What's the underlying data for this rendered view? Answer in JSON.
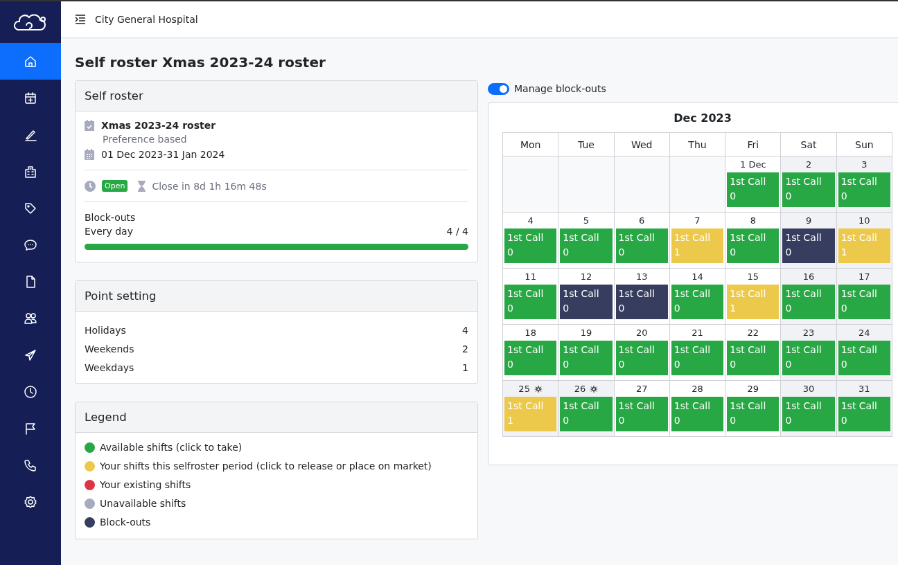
{
  "topbar": {
    "title": "City General Hospital"
  },
  "sidebar": {
    "items": [
      {
        "kind": "home",
        "selected": true
      },
      {
        "kind": "calendar-plus",
        "selected": false
      },
      {
        "kind": "pen",
        "selected": false
      },
      {
        "kind": "building",
        "selected": false
      },
      {
        "kind": "tag",
        "selected": false
      },
      {
        "kind": "chat",
        "selected": false
      },
      {
        "kind": "document",
        "selected": false
      },
      {
        "kind": "users",
        "selected": false
      },
      {
        "kind": "plane",
        "selected": false
      },
      {
        "kind": "clock",
        "selected": false
      },
      {
        "kind": "flag",
        "selected": false
      },
      {
        "kind": "phone",
        "selected": false
      },
      {
        "kind": "gear",
        "selected": false
      }
    ]
  },
  "page_title": "Self roster Xmas 2023-24 roster",
  "self_roster": {
    "heading": "Self roster",
    "name": "Xmas 2023-24 roster",
    "type": "Preference based",
    "dates": "01 Dec 2023-31 Jan 2024",
    "status": "Open",
    "countdown": "Close in 8d 1h 16m 48s",
    "blockouts_label": "Block-outs",
    "blockouts_period": "Every day",
    "blockouts_count": "4 / 4",
    "level": 1
  },
  "point_setting": {
    "heading": "Point setting",
    "rows": [
      {
        "label": "Holidays",
        "value": "4"
      },
      {
        "label": "Weekends",
        "value": "2"
      },
      {
        "label": "Weekdays",
        "value": "1"
      }
    ]
  },
  "legend": {
    "heading": "Legend",
    "items": [
      {
        "label": "Available shifts (click to take)",
        "color": "#28a745"
      },
      {
        "label": "Your shifts this selfroster period (click to release or place on market)",
        "color": "#ecc94b"
      },
      {
        "label": "Your existing shifts",
        "color": "#dc3545"
      },
      {
        "label": "Unavailable shifts",
        "color": "#a8abbd"
      },
      {
        "label": "Block-outs",
        "color": "#373d5e"
      }
    ]
  },
  "manage_blockouts": {
    "label": "Manage block-outs",
    "on": true
  },
  "calendar": {
    "month": "Dec 2023",
    "weekdays": [
      "Mon",
      "Tue",
      "Wed",
      "Thu",
      "Fri",
      "Sat",
      "Sun"
    ],
    "weeks": [
      [
        {
          "kind": "empty"
        },
        {
          "kind": "empty"
        },
        {
          "kind": "empty"
        },
        {
          "kind": "empty"
        },
        {
          "kind": "weekday",
          "day": "1 Dec",
          "shift": {
            "label": "1st Call",
            "count": "0",
            "color": "#28a745"
          }
        },
        {
          "kind": "weekend",
          "day": "2",
          "shift": {
            "label": "1st Call",
            "count": "0",
            "color": "#28a745"
          }
        },
        {
          "kind": "weekend",
          "day": "3",
          "shift": {
            "label": "1st Call",
            "count": "0",
            "color": "#28a745"
          }
        }
      ],
      [
        {
          "kind": "weekday",
          "day": "4",
          "shift": {
            "label": "1st Call",
            "count": "0",
            "color": "#28a745"
          }
        },
        {
          "kind": "weekday",
          "day": "5",
          "shift": {
            "label": "1st Call",
            "count": "0",
            "color": "#28a745"
          }
        },
        {
          "kind": "weekday",
          "day": "6",
          "shift": {
            "label": "1st Call",
            "count": "0",
            "color": "#28a745"
          }
        },
        {
          "kind": "weekday",
          "day": "7",
          "shift": {
            "label": "1st Call",
            "count": "1",
            "color": "#ecc94b"
          }
        },
        {
          "kind": "weekday",
          "day": "8",
          "shift": {
            "label": "1st Call",
            "count": "0",
            "color": "#28a745"
          }
        },
        {
          "kind": "weekend",
          "day": "9",
          "shift": {
            "label": "1st Call",
            "count": "0",
            "color": "#373d5e"
          }
        },
        {
          "kind": "weekend",
          "day": "10",
          "shift": {
            "label": "1st Call",
            "count": "1",
            "color": "#ecc94b"
          }
        }
      ],
      [
        {
          "kind": "weekday",
          "day": "11",
          "shift": {
            "label": "1st Call",
            "count": "0",
            "color": "#28a745"
          }
        },
        {
          "kind": "weekday",
          "day": "12",
          "shift": {
            "label": "1st Call",
            "count": "0",
            "color": "#373d5e"
          }
        },
        {
          "kind": "weekday",
          "day": "13",
          "shift": {
            "label": "1st Call",
            "count": "0",
            "color": "#373d5e"
          }
        },
        {
          "kind": "weekday",
          "day": "14",
          "shift": {
            "label": "1st Call",
            "count": "0",
            "color": "#28a745"
          }
        },
        {
          "kind": "weekday",
          "day": "15",
          "shift": {
            "label": "1st Call",
            "count": "1",
            "color": "#ecc94b"
          }
        },
        {
          "kind": "weekend",
          "day": "16",
          "shift": {
            "label": "1st Call",
            "count": "0",
            "color": "#28a745"
          }
        },
        {
          "kind": "weekend",
          "day": "17",
          "shift": {
            "label": "1st Call",
            "count": "0",
            "color": "#28a745"
          }
        }
      ],
      [
        {
          "kind": "weekday",
          "day": "18",
          "shift": {
            "label": "1st Call",
            "count": "0",
            "color": "#28a745"
          }
        },
        {
          "kind": "weekday",
          "day": "19",
          "shift": {
            "label": "1st Call",
            "count": "0",
            "color": "#28a745"
          }
        },
        {
          "kind": "weekday",
          "day": "20",
          "shift": {
            "label": "1st Call",
            "count": "0",
            "color": "#28a745"
          }
        },
        {
          "kind": "weekday",
          "day": "21",
          "shift": {
            "label": "1st Call",
            "count": "0",
            "color": "#28a745"
          }
        },
        {
          "kind": "weekday",
          "day": "22",
          "shift": {
            "label": "1st Call",
            "count": "0",
            "color": "#28a745"
          }
        },
        {
          "kind": "weekend",
          "day": "23",
          "shift": {
            "label": "1st Call",
            "count": "0",
            "color": "#28a745"
          }
        },
        {
          "kind": "weekend",
          "day": "24",
          "shift": {
            "label": "1st Call",
            "count": "0",
            "color": "#28a745"
          }
        }
      ],
      [
        {
          "kind": "holiday",
          "day": "25",
          "shift": {
            "label": "1st Call",
            "count": "1",
            "color": "#ecc94b"
          }
        },
        {
          "kind": "holiday",
          "day": "26",
          "shift": {
            "label": "1st Call",
            "count": "0",
            "color": "#28a745"
          }
        },
        {
          "kind": "weekday",
          "day": "27",
          "shift": {
            "label": "1st Call",
            "count": "0",
            "color": "#28a745"
          }
        },
        {
          "kind": "weekday",
          "day": "28",
          "shift": {
            "label": "1st Call",
            "count": "0",
            "color": "#28a745"
          }
        },
        {
          "kind": "weekday",
          "day": "29",
          "shift": {
            "label": "1st Call",
            "count": "0",
            "color": "#28a745"
          }
        },
        {
          "kind": "weekend",
          "day": "30",
          "shift": {
            "label": "1st Call",
            "count": "0",
            "color": "#28a745"
          }
        },
        {
          "kind": "weekend",
          "day": "31",
          "shift": {
            "label": "1st Call",
            "count": "0",
            "color": "#28a745"
          }
        }
      ]
    ]
  }
}
